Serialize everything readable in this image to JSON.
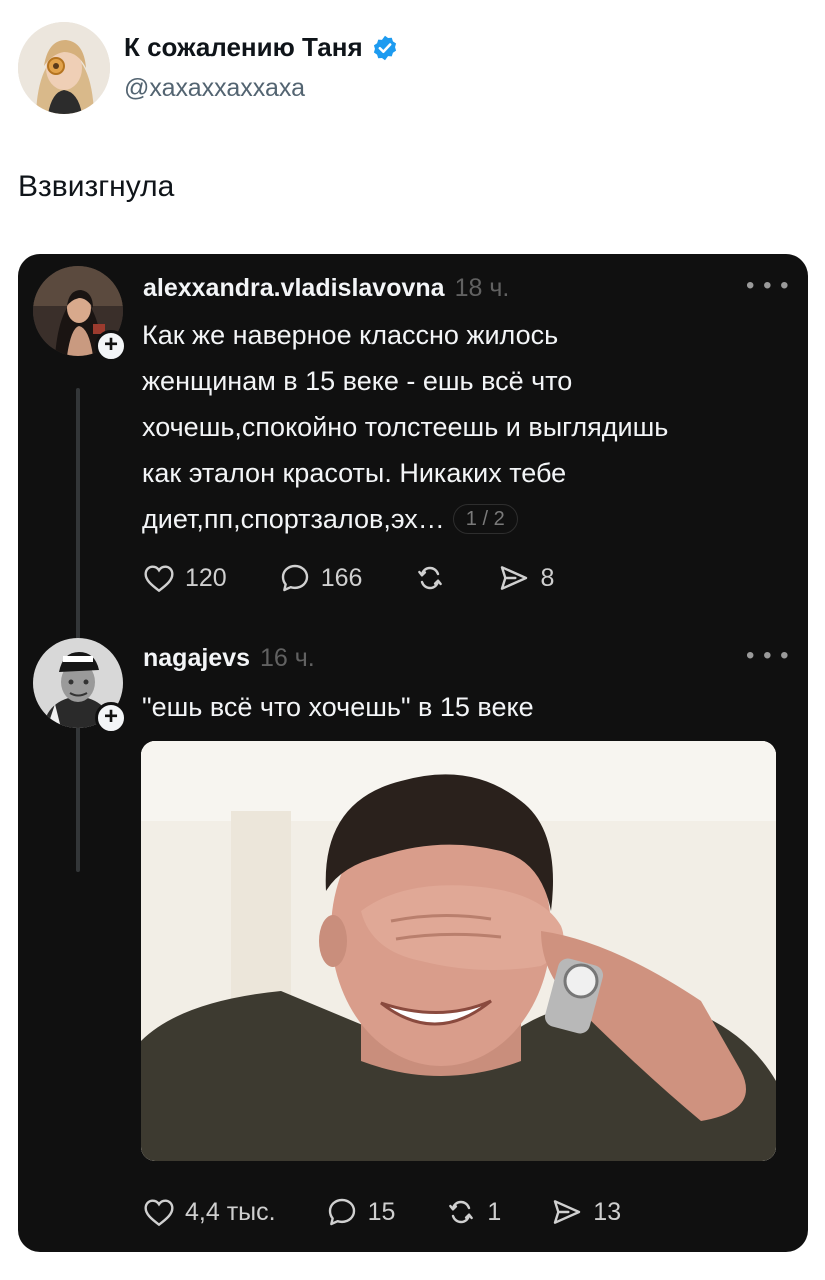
{
  "tweet": {
    "author_name": "К сожалению Таня",
    "author_handle": "@хахаххаххаха",
    "text": "Взвизгнула"
  },
  "embedded_thread": {
    "posts": [
      {
        "username": "alexxandra.vladislavovna",
        "time": "18 ч.",
        "lines": [
          "Как же наверное классно жилось",
          "женщинам в 15 веке - ешь всё что",
          "хочешь,спокойно толстеешь и выглядишь",
          "как эталон красоты. Никаких тебе",
          "диет,пп,спортзалов,эх…"
        ],
        "page_indicator": "1 / 2",
        "likes": "120",
        "replies": "166",
        "shares": "8"
      },
      {
        "username": "nagajevs",
        "time": "16 ч.",
        "text": "\"ешь всё что хочешь\" в 15 веке",
        "likes": "4,4 тыс.",
        "replies": "15",
        "reposts": "1",
        "shares": "13"
      }
    ]
  },
  "colors": {
    "verified": "#1d9bf0",
    "card_bg": "#101010",
    "card_text": "#f3f5f7",
    "muted": "#616161"
  }
}
